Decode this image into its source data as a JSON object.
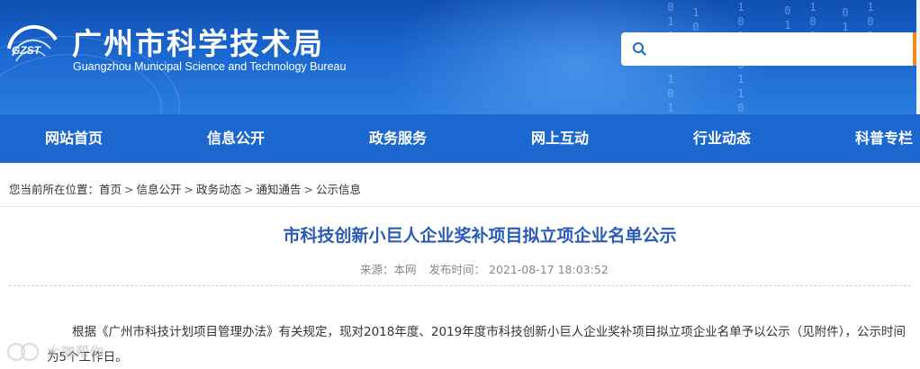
{
  "header": {
    "logo_abbr": "GZST",
    "title_cn": "广州市科学技术局",
    "title_en": "Guangzhou Municipal Science and Technology Bureau",
    "search": {
      "placeholder": "",
      "value": ""
    }
  },
  "nav": {
    "items": [
      {
        "label": "网站首页"
      },
      {
        "label": "信息公开"
      },
      {
        "label": "政务服务"
      },
      {
        "label": "网上互动"
      },
      {
        "label": "行业动态"
      },
      {
        "label": "科普专栏"
      }
    ]
  },
  "breadcrumb": {
    "prefix": "您当前所在位置：",
    "items": [
      "首页",
      "信息公开",
      "政务动态",
      "通知通告",
      "公示信息"
    ],
    "separator": ">"
  },
  "article": {
    "title": "市科技创新小巨人企业奖补项目拟立项企业名单公示",
    "source": "来源：本网",
    "published": "发布时间：  2021-08-17 18:03:52",
    "paragraph": "根据《广州市科技计划项目管理办法》有关规定，现对2018年度、2019年度市科技创新小巨人企业奖补项目拟立项企业名单予以公示（见附件），公示时间为5个工作日。"
  },
  "watermark": {
    "text": "大咖帮你"
  },
  "colors": {
    "header_blue": "#1a66cf",
    "nav_blue": "#1d67d1",
    "title_blue": "#2a5cb6",
    "search_accent": "#f08a1c"
  },
  "icons": [
    "gzst-logo-icon",
    "search-icon",
    "watermark-logo-icon"
  ]
}
